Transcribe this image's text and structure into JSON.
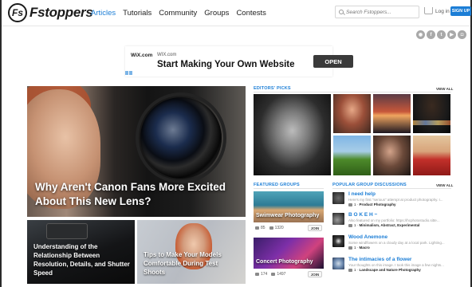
{
  "header": {
    "logo_mark": "Fs",
    "logo_text": "Fstoppers",
    "nav": [
      "Articles",
      "Tutorials",
      "Community",
      "Groups",
      "Contests"
    ],
    "search_placeholder": "Search Fstoppers...",
    "login": "Log in",
    "signup": "SIGN UP",
    "accent_color": "#1c7ed6"
  },
  "social": [
    "rss-icon",
    "facebook-icon",
    "twitter-icon",
    "youtube-icon",
    "instagram-icon"
  ],
  "ad": {
    "brand": "WiX.com",
    "url": "WIX.com",
    "title": "Start Making Your Own Website",
    "button": "OPEN"
  },
  "hero": {
    "title": "Why Aren't Canon Fans More Excited About This New Lens?"
  },
  "articles": [
    {
      "title": "Understanding of the Relationship Between Resolution, Details, and Shutter Speed"
    },
    {
      "title": "Tips to Make Your Models Comfortable During Test Shoots"
    }
  ],
  "editors_picks": {
    "label": "EDITORS' PICKS",
    "view_all": "VIEW ALL"
  },
  "featured_groups": {
    "label": "FEATURED GROUPS",
    "items": [
      {
        "name": "Swimwear Photography",
        "posts": "85",
        "members": "1320",
        "join": "JOIN"
      },
      {
        "name": "Concert Photography",
        "posts": "174",
        "members": "1497",
        "join": "JOIN"
      }
    ]
  },
  "popular_discussions": {
    "label": "POPULAR GROUP DISCUSSIONS",
    "view_all": "VIEW ALL",
    "items": [
      {
        "title": "I need help",
        "desc": "Here's my first \"serious\" attempt at product photography. I...",
        "count": "1",
        "group": "Product Photography"
      },
      {
        "title": "B O K E H ~",
        "desc": "Also featured on my portfolio: https://hcphotostudio.sitte...",
        "count": "1",
        "group": "Minimalism, Abstract, Experimental"
      },
      {
        "title": "Wood Anemone",
        "desc": "Some windflowers on a cloudy day at a local park. Lighting...",
        "count": "1",
        "group": "Macro"
      },
      {
        "title": "The intimacies of a flower",
        "desc": "Your thoughts on this image. I took this image a few nights...",
        "count": "1",
        "group": "Landscape and Nature Photography"
      }
    ]
  }
}
